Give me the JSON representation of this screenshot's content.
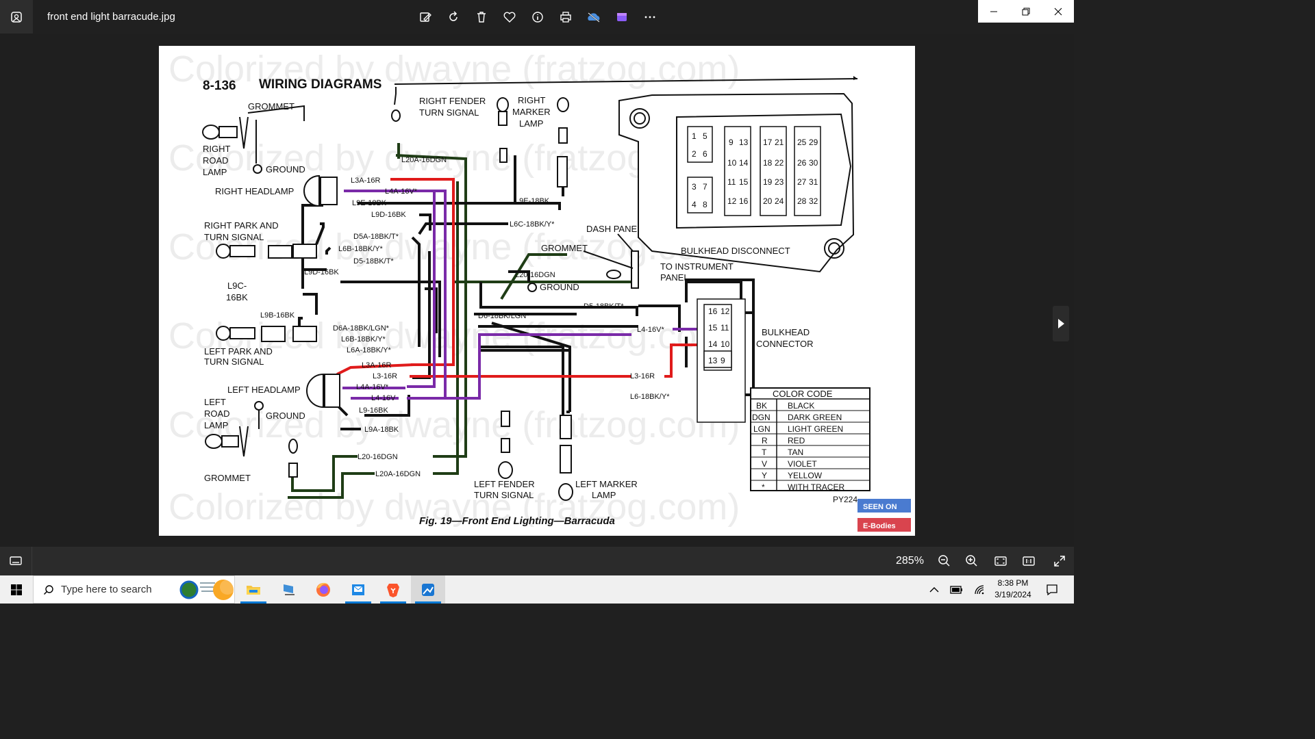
{
  "window": {
    "file_name": "front end light barracude.jpg"
  },
  "toolbar": {
    "buttons": [
      "edit-image",
      "rotate",
      "delete",
      "favorite",
      "file-info",
      "print",
      "onedrive",
      "clipchamp",
      "more"
    ]
  },
  "diagram": {
    "page_number": "8-136",
    "heading": "WIRING DIAGRAMS",
    "caption": "Fig. 19—Front End Lighting—Barracuda",
    "ref_code": "PY224",
    "watermark": "Colorized by dwayne (fratzog.com)",
    "stamp_top": "SEEN ON",
    "stamp_bottom": "E-Bodies",
    "components": {
      "grommet_top": "GROMMET",
      "right_road_lamp": [
        "RIGHT",
        "ROAD",
        "LAMP"
      ],
      "ground_top": "GROUND",
      "right_fender_turn": [
        "RIGHT FENDER",
        "TURN SIGNAL"
      ],
      "right_marker": [
        "RIGHT",
        "MARKER",
        "LAMP"
      ],
      "right_headlamp": "RIGHT HEADLAMP",
      "right_park": [
        "RIGHT PARK AND",
        "TURN SIGNAL"
      ],
      "l9c": [
        "L9C-",
        "16BK"
      ],
      "dash_panel": "DASH PANEL",
      "grommet_mid": "GROMMET",
      "bulkhead_disconnect": "BULKHEAD DISCONNECT",
      "to_instrument": [
        "TO INSTRUMENT",
        "PANEL"
      ],
      "ground_mid": "GROUND",
      "left_park": [
        "LEFT PARK AND",
        "TURN SIGNAL"
      ],
      "bulkhead_connector": [
        "BULKHEAD",
        "CONNECTOR"
      ],
      "left_headlamp": "LEFT HEADLAMP",
      "left_road_lamp": [
        "LEFT",
        "ROAD",
        "LAMP"
      ],
      "ground_bottom": "GROUND",
      "grommet_bottom": "GROMMET",
      "left_fender_turn": [
        "LEFT FENDER",
        "TURN SIGNAL"
      ],
      "left_marker": [
        "LEFT MARKER",
        "LAMP"
      ]
    },
    "wire_labels": {
      "l20a_top": "L20A-16DGN",
      "l3a_r": "L3A-16R",
      "l4a_r": "L4A-16V*",
      "l9e_r": "L9E-18BK",
      "l9d": "L9D-16BK",
      "l9e_right": "L9E-18BK",
      "l6c": "L6C-18BK/Y*",
      "d5a": "D5A-18BK/T*",
      "l6b_r": "L6B-18BK/Y*",
      "d5": "D5-18BK/T*",
      "l9d_2": "L9D-16BK",
      "l20_mid": "L20-16DGN",
      "d5_long": "D5-18BK/T*",
      "l9b": "L9B-16BK",
      "d6": "D6-18BK/LGN*",
      "d6a": "D6A-18BK/LGN*",
      "l6b_l": "L6B-18BK/Y*",
      "l6a": "L6A-18BK/Y*",
      "l4": "L4-16V*",
      "l3a_l": "L3A-16R",
      "l3_l": "L3-16R",
      "l4a_l": "L4A-16V*",
      "l4_l": "L4-16V",
      "l9": "L9-16BK",
      "l3_long": "L3-16R",
      "l6": "L6-18BK/Y*",
      "l9a": "L9A-18BK",
      "l20_bottom": "L20-16DGN",
      "l20a_bottom": "L20A-16DGN"
    },
    "fuse_numbers": [
      "1",
      "5",
      "2",
      "6",
      "3",
      "7",
      "4",
      "8",
      "9",
      "13",
      "10",
      "14",
      "11",
      "15",
      "12",
      "16",
      "17",
      "21",
      "18",
      "22",
      "19",
      "23",
      "20",
      "24",
      "25",
      "29",
      "26",
      "30",
      "27",
      "31",
      "28",
      "32"
    ],
    "connector_pins": [
      "16",
      "12",
      "15",
      "11",
      "14",
      "10",
      "13",
      "9"
    ],
    "color_code": {
      "title": "COLOR CODE",
      "rows": [
        {
          "code": "BK",
          "name": "BLACK"
        },
        {
          "code": "DGN",
          "name": "DARK GREEN"
        },
        {
          "code": "LGN",
          "name": "LIGHT GREEN"
        },
        {
          "code": "R",
          "name": "RED"
        },
        {
          "code": "T",
          "name": "TAN"
        },
        {
          "code": "V",
          "name": "VIOLET"
        },
        {
          "code": "Y",
          "name": "YELLOW"
        },
        {
          "code": "*",
          "name": "WITH TRACER"
        }
      ]
    },
    "colors": {
      "red": "#e01b1b",
      "violet": "#7a2aa8",
      "black": "#111111",
      "dark_green": "#1f3d16"
    }
  },
  "statusbar": {
    "zoom": "285%"
  },
  "taskbar": {
    "search_placeholder": "Type here to search",
    "time": "8:38 PM",
    "date": "3/19/2024"
  }
}
